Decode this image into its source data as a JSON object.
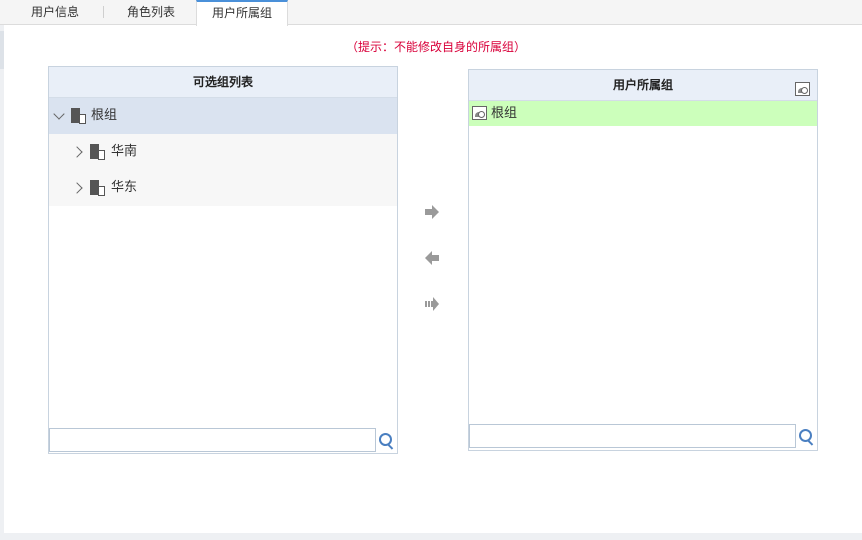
{
  "tabs": [
    {
      "label": "用户信息",
      "active": false
    },
    {
      "label": "角色列表",
      "active": false
    },
    {
      "label": "用户所属组",
      "active": true
    }
  ],
  "hint": "（提示：不能修改自身的所属组）",
  "available_groups": {
    "title": "可选组列表",
    "items": [
      {
        "label": "根组",
        "expanded": true,
        "selected": true
      },
      {
        "label": "华南",
        "expanded": false,
        "selected": false
      },
      {
        "label": "华东",
        "expanded": false,
        "selected": false
      }
    ],
    "search": {
      "placeholder": "",
      "value": ""
    }
  },
  "user_groups": {
    "title": "用户所属组",
    "items": [
      {
        "label": "根组"
      }
    ],
    "search": {
      "placeholder": "",
      "value": ""
    }
  },
  "colors": {
    "hint": "#d9003a",
    "selected_row": "#dae3f0",
    "assigned_row": "#ccffbb",
    "header": "#e9eff8"
  },
  "icons": {
    "add": "arrow-right-icon",
    "remove": "arrow-left-icon",
    "add_all": "double-arrow-right-icon",
    "search": "search-icon",
    "group": "group-icon",
    "assigned": "image-icon"
  }
}
